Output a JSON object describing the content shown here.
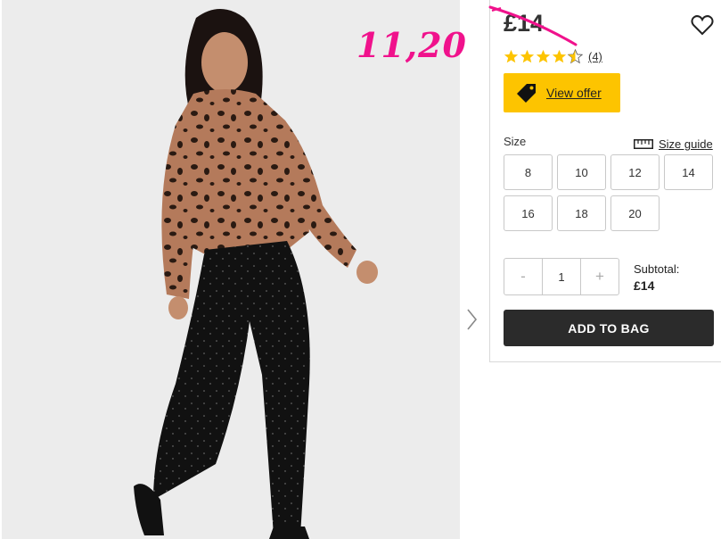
{
  "sale_note": "11,20",
  "product": {
    "price": "£14",
    "rating": {
      "value": 4.5,
      "max": 5,
      "review_count": "(4)"
    },
    "offer_label": "View offer",
    "size_label": "Size",
    "size_guide_label": "Size guide",
    "sizes": [
      "8",
      "10",
      "12",
      "14",
      "16",
      "18",
      "20"
    ],
    "quantity": "1",
    "qty_minus": "-",
    "qty_plus": "+",
    "subtotal_label": "Subtotal:",
    "subtotal_value": "£14",
    "add_to_bag_label": "ADD TO BAG"
  },
  "colors": {
    "sale_note": "#f0128c",
    "star": "#fdc400",
    "offer_bg": "#fdc400",
    "add_to_bag_bg": "#2b2b2b"
  },
  "icons": [
    "heart-icon",
    "star-icon",
    "price-tag-icon",
    "ruler-icon",
    "chevron-right-icon"
  ]
}
